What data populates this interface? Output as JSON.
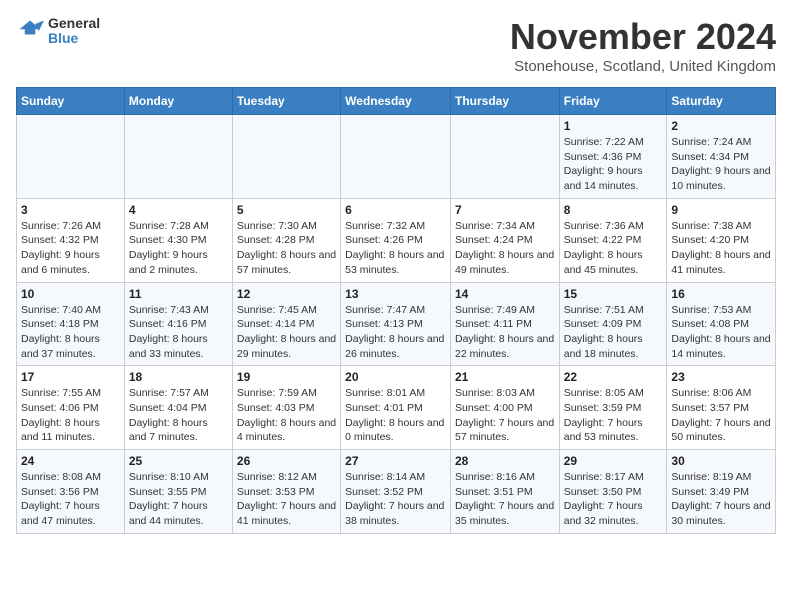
{
  "logo": {
    "line1": "General",
    "line2": "Blue"
  },
  "title": "November 2024",
  "location": "Stonehouse, Scotland, United Kingdom",
  "weekdays": [
    "Sunday",
    "Monday",
    "Tuesday",
    "Wednesday",
    "Thursday",
    "Friday",
    "Saturday"
  ],
  "weeks": [
    [
      {
        "day": "",
        "info": ""
      },
      {
        "day": "",
        "info": ""
      },
      {
        "day": "",
        "info": ""
      },
      {
        "day": "",
        "info": ""
      },
      {
        "day": "",
        "info": ""
      },
      {
        "day": "1",
        "info": "Sunrise: 7:22 AM\nSunset: 4:36 PM\nDaylight: 9 hours and 14 minutes."
      },
      {
        "day": "2",
        "info": "Sunrise: 7:24 AM\nSunset: 4:34 PM\nDaylight: 9 hours and 10 minutes."
      }
    ],
    [
      {
        "day": "3",
        "info": "Sunrise: 7:26 AM\nSunset: 4:32 PM\nDaylight: 9 hours and 6 minutes."
      },
      {
        "day": "4",
        "info": "Sunrise: 7:28 AM\nSunset: 4:30 PM\nDaylight: 9 hours and 2 minutes."
      },
      {
        "day": "5",
        "info": "Sunrise: 7:30 AM\nSunset: 4:28 PM\nDaylight: 8 hours and 57 minutes."
      },
      {
        "day": "6",
        "info": "Sunrise: 7:32 AM\nSunset: 4:26 PM\nDaylight: 8 hours and 53 minutes."
      },
      {
        "day": "7",
        "info": "Sunrise: 7:34 AM\nSunset: 4:24 PM\nDaylight: 8 hours and 49 minutes."
      },
      {
        "day": "8",
        "info": "Sunrise: 7:36 AM\nSunset: 4:22 PM\nDaylight: 8 hours and 45 minutes."
      },
      {
        "day": "9",
        "info": "Sunrise: 7:38 AM\nSunset: 4:20 PM\nDaylight: 8 hours and 41 minutes."
      }
    ],
    [
      {
        "day": "10",
        "info": "Sunrise: 7:40 AM\nSunset: 4:18 PM\nDaylight: 8 hours and 37 minutes."
      },
      {
        "day": "11",
        "info": "Sunrise: 7:43 AM\nSunset: 4:16 PM\nDaylight: 8 hours and 33 minutes."
      },
      {
        "day": "12",
        "info": "Sunrise: 7:45 AM\nSunset: 4:14 PM\nDaylight: 8 hours and 29 minutes."
      },
      {
        "day": "13",
        "info": "Sunrise: 7:47 AM\nSunset: 4:13 PM\nDaylight: 8 hours and 26 minutes."
      },
      {
        "day": "14",
        "info": "Sunrise: 7:49 AM\nSunset: 4:11 PM\nDaylight: 8 hours and 22 minutes."
      },
      {
        "day": "15",
        "info": "Sunrise: 7:51 AM\nSunset: 4:09 PM\nDaylight: 8 hours and 18 minutes."
      },
      {
        "day": "16",
        "info": "Sunrise: 7:53 AM\nSunset: 4:08 PM\nDaylight: 8 hours and 14 minutes."
      }
    ],
    [
      {
        "day": "17",
        "info": "Sunrise: 7:55 AM\nSunset: 4:06 PM\nDaylight: 8 hours and 11 minutes."
      },
      {
        "day": "18",
        "info": "Sunrise: 7:57 AM\nSunset: 4:04 PM\nDaylight: 8 hours and 7 minutes."
      },
      {
        "day": "19",
        "info": "Sunrise: 7:59 AM\nSunset: 4:03 PM\nDaylight: 8 hours and 4 minutes."
      },
      {
        "day": "20",
        "info": "Sunrise: 8:01 AM\nSunset: 4:01 PM\nDaylight: 8 hours and 0 minutes."
      },
      {
        "day": "21",
        "info": "Sunrise: 8:03 AM\nSunset: 4:00 PM\nDaylight: 7 hours and 57 minutes."
      },
      {
        "day": "22",
        "info": "Sunrise: 8:05 AM\nSunset: 3:59 PM\nDaylight: 7 hours and 53 minutes."
      },
      {
        "day": "23",
        "info": "Sunrise: 8:06 AM\nSunset: 3:57 PM\nDaylight: 7 hours and 50 minutes."
      }
    ],
    [
      {
        "day": "24",
        "info": "Sunrise: 8:08 AM\nSunset: 3:56 PM\nDaylight: 7 hours and 47 minutes."
      },
      {
        "day": "25",
        "info": "Sunrise: 8:10 AM\nSunset: 3:55 PM\nDaylight: 7 hours and 44 minutes."
      },
      {
        "day": "26",
        "info": "Sunrise: 8:12 AM\nSunset: 3:53 PM\nDaylight: 7 hours and 41 minutes."
      },
      {
        "day": "27",
        "info": "Sunrise: 8:14 AM\nSunset: 3:52 PM\nDaylight: 7 hours and 38 minutes."
      },
      {
        "day": "28",
        "info": "Sunrise: 8:16 AM\nSunset: 3:51 PM\nDaylight: 7 hours and 35 minutes."
      },
      {
        "day": "29",
        "info": "Sunrise: 8:17 AM\nSunset: 3:50 PM\nDaylight: 7 hours and 32 minutes."
      },
      {
        "day": "30",
        "info": "Sunrise: 8:19 AM\nSunset: 3:49 PM\nDaylight: 7 hours and 30 minutes."
      }
    ]
  ]
}
